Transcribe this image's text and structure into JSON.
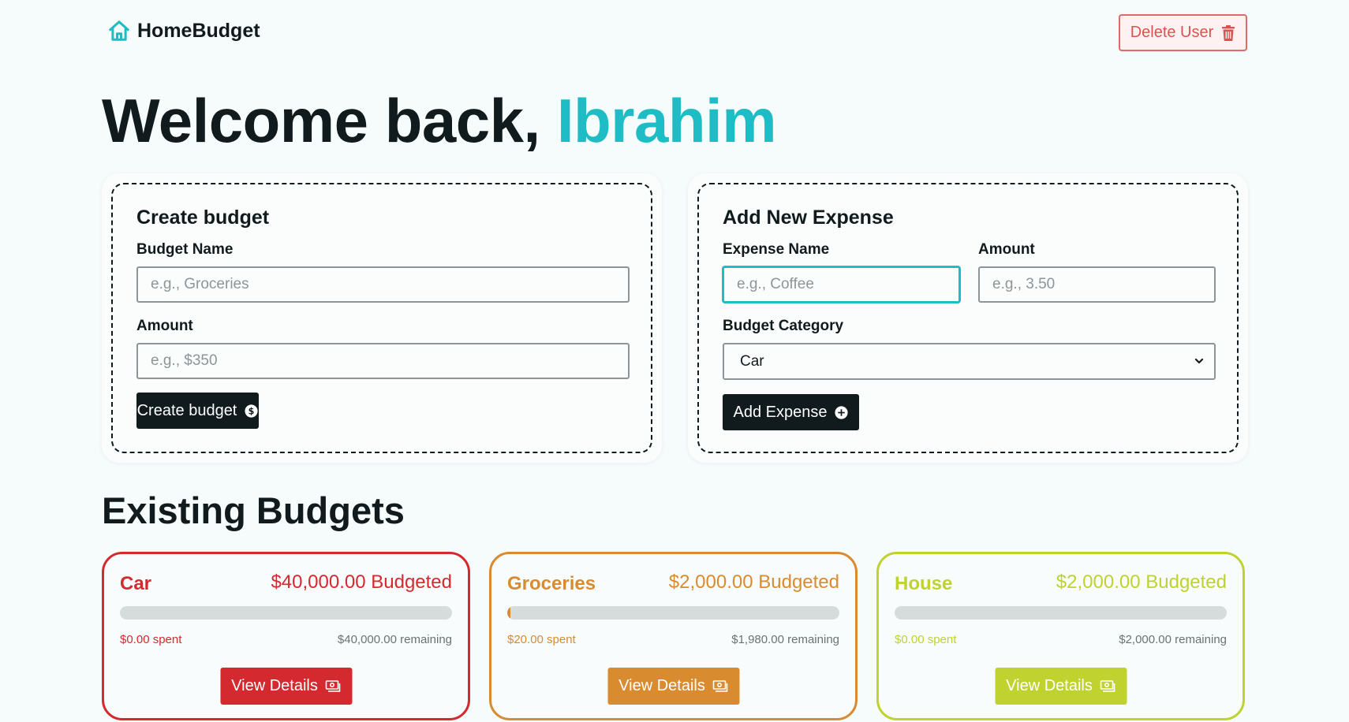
{
  "app": {
    "logo_text": "HomeBudget",
    "delete_label": "Delete User"
  },
  "welcome": {
    "prefix": "Welcome back, ",
    "name": "Ibrahim"
  },
  "create_budget": {
    "title": "Create budget",
    "name_label": "Budget Name",
    "name_placeholder": "e.g., Groceries",
    "amount_label": "Amount",
    "amount_placeholder": "e.g., $350",
    "button_label": "Create budget"
  },
  "add_expense": {
    "title": "Add New Expense",
    "name_label": "Expense Name",
    "name_placeholder": "e.g., Coffee",
    "amount_label": "Amount",
    "amount_placeholder": "e.g., 3.50",
    "category_label": "Budget Category",
    "category_value": "Car",
    "button_label": "Add Expense"
  },
  "existing": {
    "title": "Existing Budgets",
    "view_label": "View Details",
    "budgets": [
      {
        "name": "Car",
        "budgeted": "$40,000.00 Budgeted",
        "spent": "$0.00 spent",
        "remaining": "$40,000.00 remaining",
        "progress": 0,
        "color": "#d42a2f"
      },
      {
        "name": "Groceries",
        "budgeted": "$2,000.00 Budgeted",
        "spent": "$20.00 spent",
        "remaining": "$1,980.00 remaining",
        "progress": 0.01,
        "color": "#d98b2f"
      },
      {
        "name": "House",
        "budgeted": "$2,000.00 Budgeted",
        "spent": "$0.00 spent",
        "remaining": "$2,000.00 remaining",
        "progress": 0,
        "color": "#bfd22f"
      }
    ]
  },
  "colors": {
    "accent": "#1ebcc4",
    "dark": "#111a1c",
    "danger": "#d95353"
  }
}
